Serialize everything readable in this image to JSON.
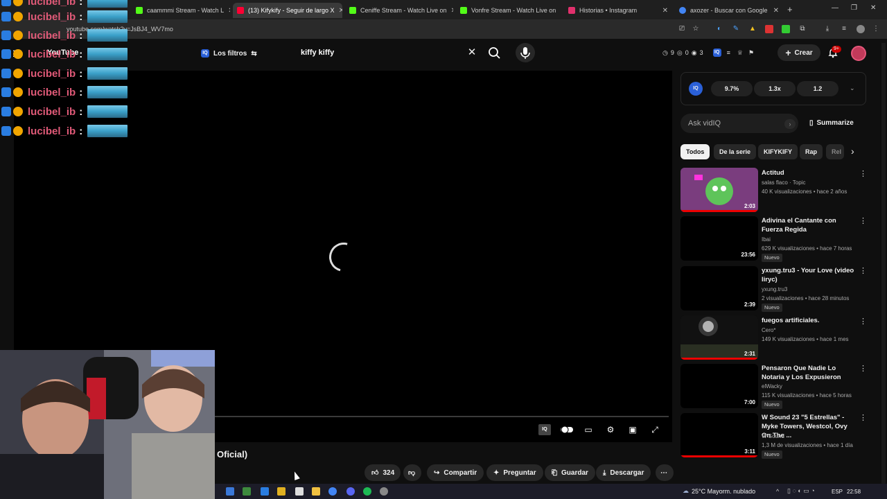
{
  "browser": {
    "tabs": [
      {
        "label": "caammmi Stream - Watch L",
        "color": "#53fc18"
      },
      {
        "label": "(13) Kifykify - Seguir de largo X",
        "color": "#ff0033",
        "active": true
      },
      {
        "label": "Ceniffe Stream - Watch Live on",
        "color": "#53fc18"
      },
      {
        "label": "Vonfre Stream - Watch Live on",
        "color": "#53fc18"
      },
      {
        "label": "Historias • Instagram",
        "color": "#e1306c"
      },
      {
        "label": "axozer - Buscar con Google",
        "color": "#4285f4"
      }
    ],
    "url": "youtube.com/watch?v=JsBJ4_WV7mo"
  },
  "header": {
    "logo": "YouTube",
    "filters_label": "Los filtros",
    "search_value": "kiffy kiffy",
    "stats": [
      "9",
      "0",
      "3"
    ],
    "create_label": "Crear",
    "notif_count": "9+"
  },
  "chat": {
    "username": "lucibel_ib",
    "separator": ":"
  },
  "player": {
    "title_fragment": "Oficial)"
  },
  "actions": {
    "likes": "324",
    "share": "Compartir",
    "ask": "Preguntar",
    "save": "Guardar",
    "download": "Descargar"
  },
  "vidiq": {
    "stat1": "9.7%",
    "stat2": "1.3x",
    "stat3": "1.2",
    "ask_placeholder": "Ask vidIQ",
    "summarize": "Summarize"
  },
  "chips": [
    "Todos",
    "De la serie",
    "KIFYKIFY",
    "Rap",
    "Rel"
  ],
  "videos": [
    {
      "title": "Actitud",
      "channel": "salas flaco · Topic",
      "meta": "40 K visualizaciones • hace 2 años",
      "duration": "2:03",
      "badge": ""
    },
    {
      "title": "Adivina el Cantante con Fuerza Regida",
      "channel": "Ibai",
      "meta": "629 K visualizaciones • hace 7 horas",
      "duration": "23:56",
      "badge": "Nuevo"
    },
    {
      "title": "yxung.tru3 - Your Love (video liryc)",
      "channel": "yxung.tru3",
      "meta": "2 visualizaciones • hace 28 minutos",
      "duration": "2:39",
      "badge": "Nuevo"
    },
    {
      "title": "fuegos artificiales.",
      "channel": "Cero*",
      "meta": "149 K visualizaciones • hace 1 mes",
      "duration": "2:31",
      "badge": ""
    },
    {
      "title": "Pensaron Que Nadie Lo Notaria y Los Expusieron",
      "channel": "elWacky",
      "meta": "115 K visualizaciones • hace 5 horas",
      "duration": "7:00",
      "badge": "Nuevo"
    },
    {
      "title": "W Sound 23 \"5 Estrellas\" - Myke Towers, Westcol, Ovy On The ...",
      "channel": "W Sound",
      "meta": "1,3 M de visualizaciones • hace 1 día",
      "duration": "3:11",
      "badge": "Nuevo"
    }
  ],
  "taskbar": {
    "weather": "25°C  Mayorm. nublado",
    "lang": "ESP",
    "time": "22:58"
  }
}
